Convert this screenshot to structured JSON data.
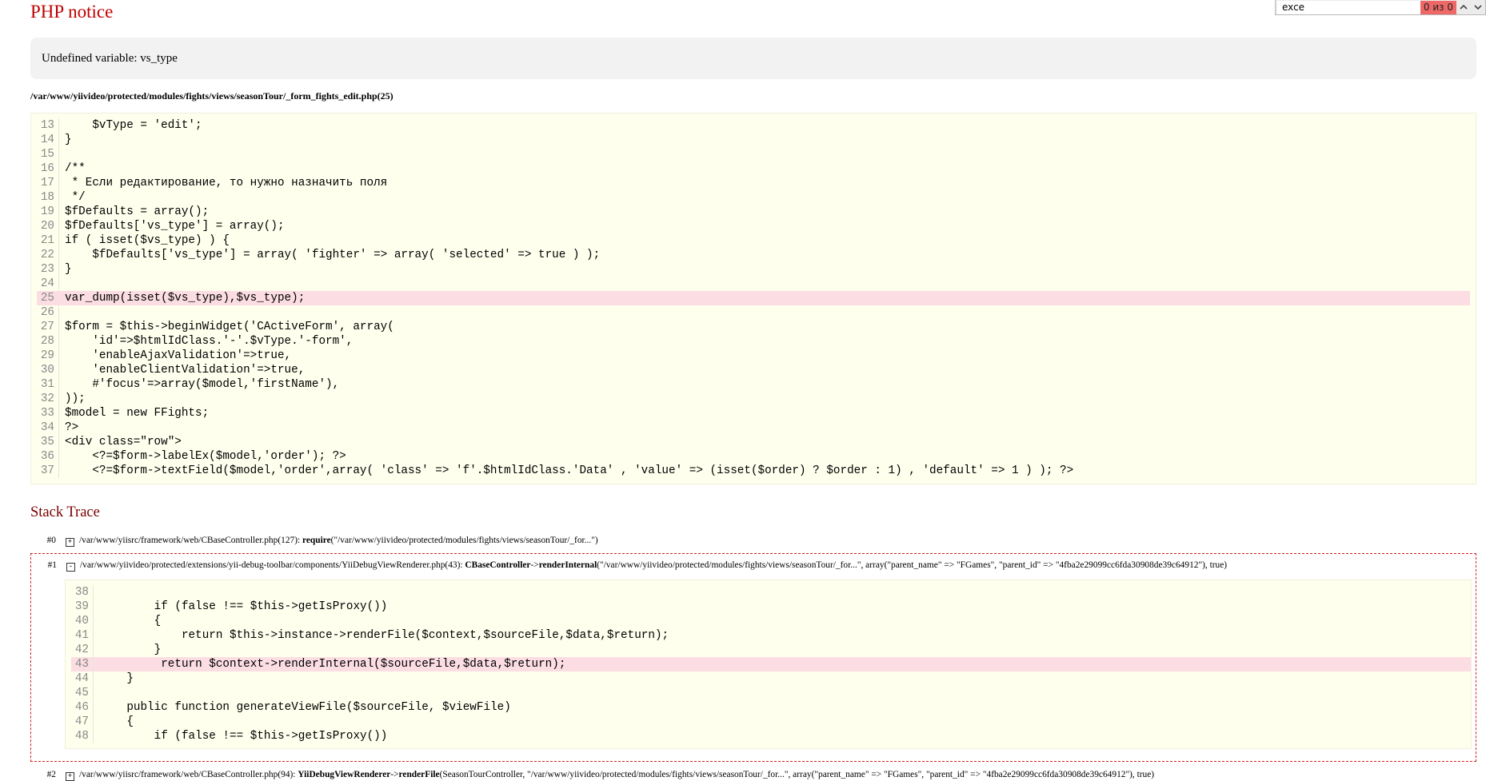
{
  "title": "PHP notice",
  "message": "Undefined variable: vs_type",
  "file_path": "/var/www/yiivideo/protected/modules/fights/views/seasonTour/_form_fights_edit.php(25)",
  "source": {
    "highlight_line": "25",
    "lines": [
      {
        "n": "13",
        "code": "    $vType = 'edit';"
      },
      {
        "n": "14",
        "code": "}"
      },
      {
        "n": "15",
        "code": ""
      },
      {
        "n": "16",
        "code": "/**"
      },
      {
        "n": "17",
        "code": " * Если редактирование, то нужно назначить поля"
      },
      {
        "n": "18",
        "code": " */"
      },
      {
        "n": "19",
        "code": "$fDefaults = array();"
      },
      {
        "n": "20",
        "code": "$fDefaults['vs_type'] = array();"
      },
      {
        "n": "21",
        "code": "if ( isset($vs_type) ) {"
      },
      {
        "n": "22",
        "code": "    $fDefaults['vs_type'] = array( 'fighter' => array( 'selected' => true ) );"
      },
      {
        "n": "23",
        "code": "}"
      },
      {
        "n": "24",
        "code": ""
      },
      {
        "n": "25",
        "code": "var_dump(isset($vs_type),$vs_type);"
      },
      {
        "n": "26",
        "code": ""
      },
      {
        "n": "27",
        "code": "$form = $this->beginWidget('CActiveForm', array("
      },
      {
        "n": "28",
        "code": "    'id'=>$htmlIdClass.'-'.$vType.'-form',"
      },
      {
        "n": "29",
        "code": "    'enableAjaxValidation'=>true,"
      },
      {
        "n": "30",
        "code": "    'enableClientValidation'=>true,"
      },
      {
        "n": "31",
        "code": "    #'focus'=>array($model,'firstName'),"
      },
      {
        "n": "32",
        "code": "));"
      },
      {
        "n": "33",
        "code": "$model = new FFights;"
      },
      {
        "n": "34",
        "code": "?>"
      },
      {
        "n": "35",
        "code": "<div class=\"row\">"
      },
      {
        "n": "36",
        "code": "    <?=$form->labelEx($model,'order'); ?>"
      },
      {
        "n": "37",
        "code": "    <?=$form->textField($model,'order',array( 'class' => 'f'.$htmlIdClass.'Data' , 'value' => (isset($order) ? $order : 1) , 'default' => 1 ) ); ?>"
      }
    ]
  },
  "stack_title": "Stack Trace",
  "trace": [
    {
      "num": "#0",
      "toggle": "+",
      "file": "/var/www/yiisrc/framework/web/CBaseController.php(127): ",
      "class": "",
      "op": "",
      "method": "require",
      "args": "(\"/var/www/yiivideo/protected/modules/fights/views/seasonTour/_for...\")"
    },
    {
      "num": "#1",
      "toggle": "-",
      "file": "/var/www/yiivideo/protected/extensions/yii-debug-toolbar/components/YiiDebugViewRenderer.php(43): ",
      "class": "CBaseController",
      "op": "->",
      "method": "renderInternal",
      "args": "(\"/var/www/yiivideo/protected/modules/fights/views/seasonTour/_for...\", array(\"parent_name\" => \"FGames\", \"parent_id\" => \"4fba2e29099cc6fda30908de39c64912\"), true)",
      "source": {
        "highlight_line": "43",
        "lines": [
          {
            "n": "38",
            "code": ""
          },
          {
            "n": "39",
            "code": "        if (false !== $this->getIsProxy())"
          },
          {
            "n": "40",
            "code": "        {"
          },
          {
            "n": "41",
            "code": "            return $this->instance->renderFile($context,$sourceFile,$data,$return);"
          },
          {
            "n": "42",
            "code": "        }"
          },
          {
            "n": "43",
            "code": "         return $context->renderInternal($sourceFile,$data,$return);"
          },
          {
            "n": "44",
            "code": "    }"
          },
          {
            "n": "45",
            "code": ""
          },
          {
            "n": "46",
            "code": "    public function generateViewFile($sourceFile, $viewFile)"
          },
          {
            "n": "47",
            "code": "    {"
          },
          {
            "n": "48",
            "code": "        if (false !== $this->getIsProxy())"
          }
        ]
      }
    },
    {
      "num": "#2",
      "toggle": "+",
      "file": "/var/www/yiisrc/framework/web/CBaseController.php(94): ",
      "class": "YiiDebugViewRenderer",
      "op": "->",
      "method": "renderFile",
      "args": "(SeasonTourController, \"/var/www/yiivideo/protected/modules/fights/views/seasonTour/_for...\", array(\"parent_name\" => \"FGames\", \"parent_id\" => \"4fba2e29099cc6fda30908de39c64912\"), true)"
    }
  ],
  "find_bar": {
    "query": "exce",
    "count": "0 из 0",
    "prev_icon": "chevron-up-icon",
    "next_icon": "chevron-down-icon"
  },
  "colors": {
    "title": "#c00000",
    "highlight": "#fbdde3",
    "code_bg": "#ffffee",
    "message_bg": "#f2f2f2",
    "trace_border": "#cc2222"
  }
}
